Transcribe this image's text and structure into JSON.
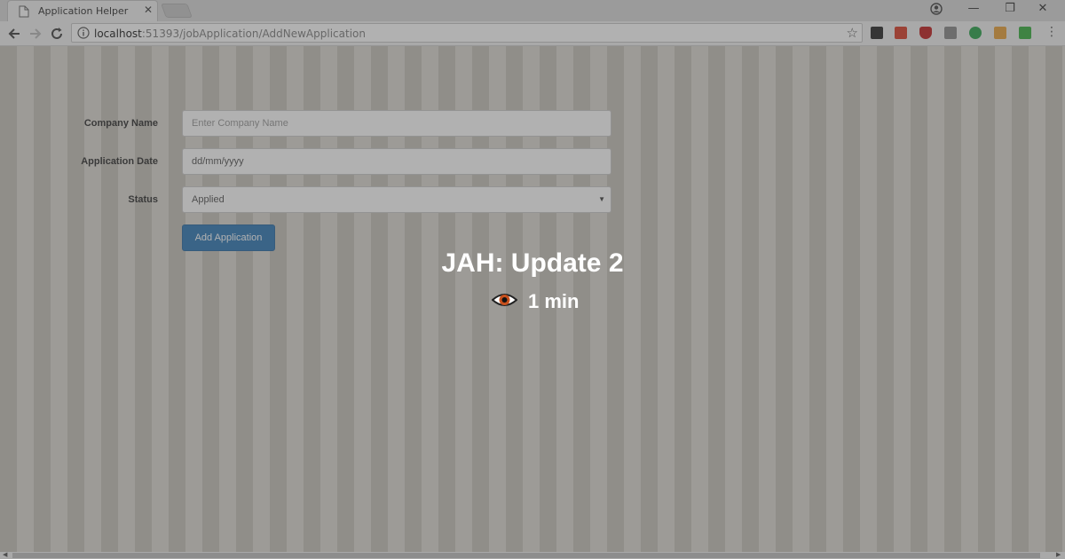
{
  "browser": {
    "tab_title": "Application Helper",
    "tab_close": "✕",
    "url_host": "localhost",
    "url_rest": ":51393/jobApplication/AddNewApplication",
    "window_controls": [
      "—",
      "❐",
      "✕"
    ],
    "icons": [
      "page-icon",
      "back-icon",
      "forward-icon",
      "reload-icon",
      "info-icon",
      "star-icon",
      "profile-icon",
      "menu-icon"
    ],
    "extension_colors": [
      "#2b2b2b",
      "#d9412b",
      "#c22424",
      "#8a8a8a",
      "#2da44e",
      "#e8a33d",
      "#3cb043",
      "#888888"
    ]
  },
  "form": {
    "company_label": "Company Name",
    "company_placeholder": "Enter Company Name",
    "date_label": "Application Date",
    "date_value": "dd/mm/yyyy",
    "status_label": "Status",
    "status_value": "Applied",
    "submit_label": "Add Application"
  },
  "overlay": {
    "title": "JAH: Update 2",
    "read_time": "1 min"
  },
  "colors": {
    "button": "#337ab7",
    "stripe_dark": "#c7c3bb",
    "stripe_light": "#dcd9d3"
  }
}
